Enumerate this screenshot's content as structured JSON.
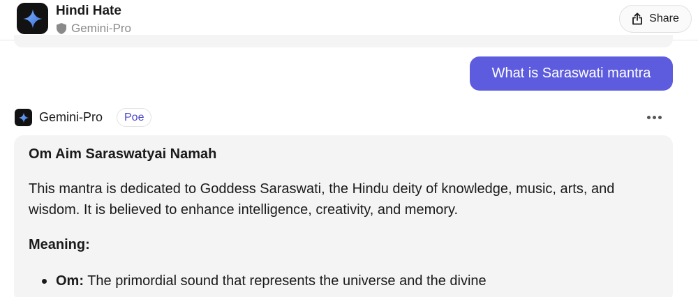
{
  "header": {
    "title": "Hindi Hate",
    "bot_name": "Gemini-Pro",
    "share_label": "Share"
  },
  "conversation": {
    "user_message": "What is Saraswati mantra",
    "bot": {
      "name": "Gemini-Pro",
      "badge": "Poe"
    },
    "response": {
      "heading": "Om Aim Saraswatyai Namah",
      "paragraph": "This mantra is dedicated to Goddess Saraswati, the Hindu deity of knowledge, music, arts, and wisdom. It is believed to enhance intelligence, creativity, and memory.",
      "meaning_label": "Meaning:",
      "items": [
        {
          "term": "Om:",
          "text": " The primordial sound that represents the universe and the divine"
        }
      ]
    }
  },
  "colors": {
    "accent": "#5d5cde",
    "badge_text": "#4b48c9",
    "card_bg": "#f4f4f5"
  },
  "icons": {
    "app": "sparkle-icon",
    "verified": "shield-icon",
    "share": "share-icon",
    "more": "more-icon"
  }
}
